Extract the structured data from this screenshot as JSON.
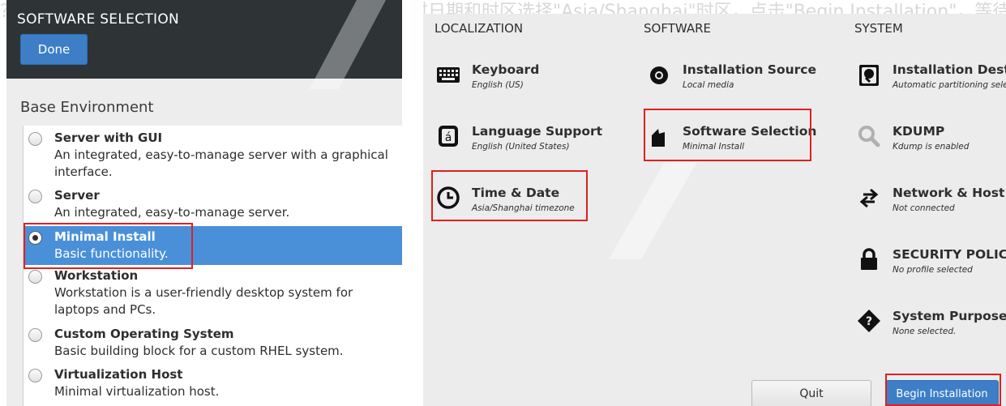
{
  "background_text": "？选择，以从不同的安装方式中选取，第二项（安装时日期和时区选择\"Asia/Shanghai\"时区，点击\"Begin Installation\"，等待安装完成即可）",
  "software_selection": {
    "title": "SOFTWARE SELECTION",
    "done_label": "Done",
    "base_env_heading": "Base Environment",
    "environments": [
      {
        "name": "Server with GUI",
        "desc": "An integrated, easy-to-manage server with a graphical",
        "desc2": "interface.",
        "selected": false
      },
      {
        "name": "Server",
        "desc": "An integrated, easy-to-manage server.",
        "desc2": "",
        "selected": false
      },
      {
        "name": "Minimal Install",
        "desc": "Basic functionality.",
        "desc2": "",
        "selected": true
      },
      {
        "name": "Workstation",
        "desc": "Workstation is a user-friendly desktop system for",
        "desc2": "laptops and PCs.",
        "selected": false
      },
      {
        "name": "Custom Operating System",
        "desc": "Basic building block for a custom RHEL system.",
        "desc2": "",
        "selected": false
      },
      {
        "name": "Virtualization Host",
        "desc": "Minimal virtualization host.",
        "desc2": "",
        "selected": false
      }
    ]
  },
  "summary": {
    "localization_heading": "LOCALIZATION",
    "software_heading": "SOFTWARE",
    "system_heading": "SYSTEM",
    "keyboard": {
      "title": "Keyboard",
      "status": "English (US)",
      "icon": "keyboard-icon"
    },
    "language": {
      "title": "Language Support",
      "status": "English (United States)",
      "icon": "language-icon"
    },
    "time_date": {
      "title": "Time & Date",
      "status": "Asia/Shanghai timezone",
      "icon": "clock-icon"
    },
    "install_source": {
      "title": "Installation Source",
      "status": "Local media",
      "icon": "disc-icon"
    },
    "software_selection": {
      "title": "Software Selection",
      "status": "Minimal Install",
      "icon": "package-icon"
    },
    "install_dest": {
      "title": "Installation Destir",
      "status": "Automatic partitioning sele",
      "icon": "harddisk-icon"
    },
    "kdump": {
      "title": "KDUMP",
      "status": "Kdump is enabled",
      "icon": "search-icon"
    },
    "network": {
      "title": "Network & Host I",
      "status": "Not connected",
      "icon": "network-arrows-icon"
    },
    "security": {
      "title": "SECURITY POLICY",
      "status": "No profile selected",
      "icon": "lock-icon"
    },
    "purpose": {
      "title": "System Purpose",
      "status": "None selected.",
      "icon": "question-diamond-icon"
    },
    "quit_label": "Quit",
    "begin_label": "Begin Installation"
  },
  "colors": {
    "accent_blue": "#3d7ec7",
    "selection_blue": "#4a90d9",
    "highlight_red": "#e02020",
    "header_dark": "#2e3436"
  }
}
